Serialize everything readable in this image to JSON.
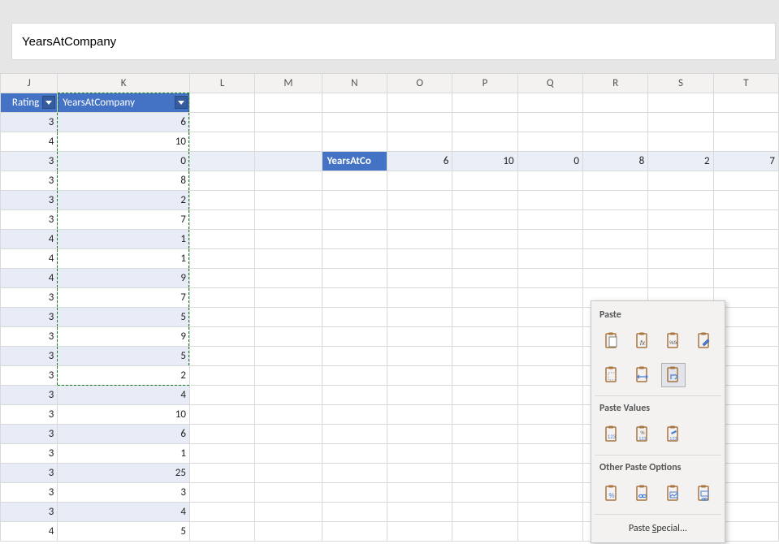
{
  "formulaBar": {
    "value": "YearsAtCompany"
  },
  "columnHeaders": [
    "J",
    "K",
    "L",
    "M",
    "N",
    "O",
    "P",
    "Q",
    "R",
    "S",
    "T"
  ],
  "tableHeaders": {
    "rating": "Rating",
    "years": "YearsAtCompany"
  },
  "ratingValues": [
    3,
    4,
    3,
    3,
    3,
    3,
    4,
    4,
    4,
    3,
    3,
    3,
    3,
    3,
    3,
    3,
    3,
    3,
    3,
    3,
    3,
    4
  ],
  "yearsValues": [
    6,
    10,
    0,
    8,
    2,
    7,
    1,
    1,
    9,
    7,
    5,
    9,
    5,
    2,
    4,
    10,
    6,
    1,
    25,
    3,
    4,
    5
  ],
  "marqueeRowsEnd": 13,
  "pastedRow": {
    "label": "YearsAtCo",
    "fullLabel": "YearsAtCompany",
    "values": [
      6,
      10,
      0,
      8,
      2,
      7
    ]
  },
  "contextMenu": {
    "paste": "Paste",
    "pasteValues": "Paste Values",
    "otherPaste": "Other Paste Options",
    "pasteSpecial1": "Paste ",
    "pasteSpecialUnderline": "S",
    "pasteSpecial2": "pecial...",
    "icons": {
      "r1": [
        "paste",
        "paste-formulas",
        "paste-formulas-number-fmt",
        "paste-source-formatting"
      ],
      "r2": [
        "paste-no-borders",
        "paste-keep-col-width",
        "paste-transpose"
      ],
      "r3": [
        "paste-values",
        "paste-values-number-fmt",
        "paste-values-source-fmt"
      ],
      "r4": [
        "paste-formatting",
        "paste-link",
        "paste-picture",
        "paste-linked-picture"
      ]
    },
    "badges": {
      "fx": "fx",
      "pctfx": "%fx",
      "n123": "123",
      "pct123": "%",
      "pct": "%",
      "link": "∞",
      "pic": "▭",
      "brush": "✎"
    }
  }
}
